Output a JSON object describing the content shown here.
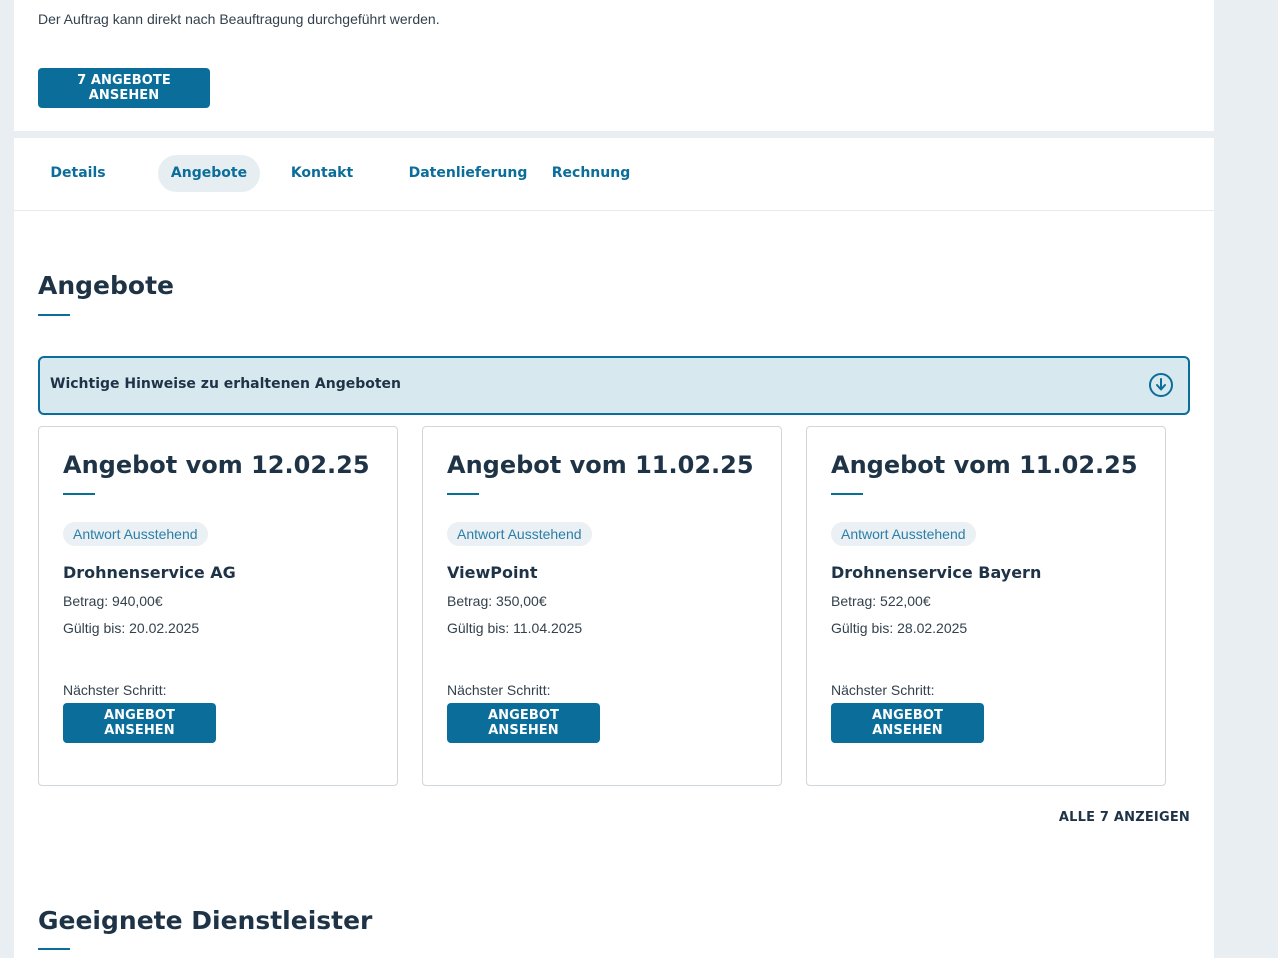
{
  "colors": {
    "primary": "#0b6d9a",
    "heading": "#1f3347",
    "page_bg": "#e9eef2",
    "notice_bg": "#d8e8ef",
    "badge_bg": "#eaf0f3"
  },
  "intro": {
    "text": "Der Auftrag kann direkt nach Beauftragung durchgeführt werden.",
    "view_offers_button": "7 ANGEBOTE ANSEHEN"
  },
  "tabs": [
    {
      "label": "Details",
      "active": false
    },
    {
      "label": "Angebote",
      "active": true
    },
    {
      "label": "Kontakt",
      "active": false
    },
    {
      "label": "Datenlieferung",
      "active": false
    },
    {
      "label": "Rechnung",
      "active": false
    }
  ],
  "offers_section": {
    "title": "Angebote",
    "notice": {
      "label": "Wichtige Hinweise zu erhaltenen Angeboten",
      "icon": "arrow-down-circle-icon"
    },
    "offers": [
      {
        "title": "Angebot vom 12.02.25",
        "status": "Antwort Ausstehend",
        "provider": "Drohnenservice AG",
        "amount": "Betrag: 940,00€",
        "valid_until": "Gültig bis: 20.02.2025",
        "next_step_label": "Nächster Schritt:",
        "button": "ANGEBOT ANSEHEN"
      },
      {
        "title": "Angebot vom 11.02.25",
        "status": "Antwort Ausstehend",
        "provider": "ViewPoint",
        "amount": "Betrag: 350,00€",
        "valid_until": "Gültig bis: 11.04.2025",
        "next_step_label": "Nächster Schritt:",
        "button": "ANGEBOT ANSEHEN"
      },
      {
        "title": "Angebot vom 11.02.25",
        "status": "Antwort Ausstehend",
        "provider": "Drohnenservice Bayern",
        "amount": "Betrag: 522,00€",
        "valid_until": "Gültig bis: 28.02.2025",
        "next_step_label": "Nächster Schritt:",
        "button": "ANGEBOT ANSEHEN"
      }
    ],
    "show_all_link": "ALLE 7 ANZEIGEN"
  },
  "providers_section": {
    "title": "Geeignete Dienstleister"
  }
}
